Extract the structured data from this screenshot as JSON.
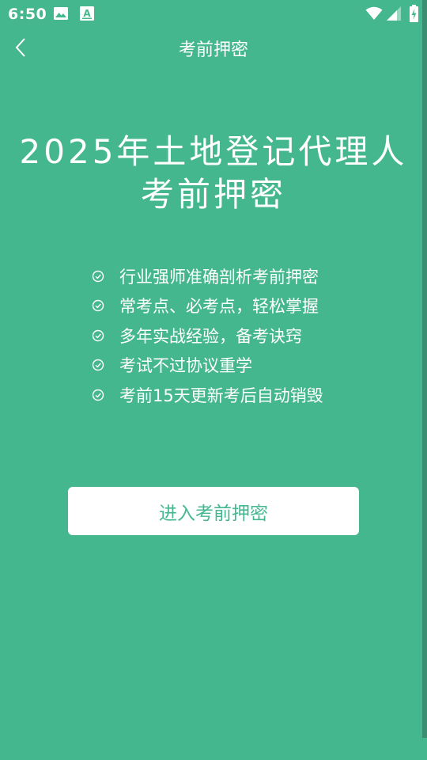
{
  "status_bar": {
    "time": "6:50",
    "icons": [
      "image-icon",
      "a-text-icon",
      "wifi-icon",
      "signal-icon",
      "battery-charging-icon"
    ]
  },
  "nav": {
    "title": "考前押密",
    "back_icon": "chevron-left-icon"
  },
  "hero": {
    "title_line1": "2025年土地登记代理人",
    "title_line2": "考前押密"
  },
  "features": [
    "行业强师准确剖析考前押密",
    "常考点、必考点，轻松掌握",
    "多年实战经验，备考诀窍",
    "考试不过协议重学",
    "考前15天更新考后自动销毁"
  ],
  "cta": {
    "label": "进入考前押密"
  },
  "colors": {
    "background": "#45b78f",
    "text": "#ffffff",
    "button_bg": "#ffffff",
    "button_text": "#45b78f"
  }
}
